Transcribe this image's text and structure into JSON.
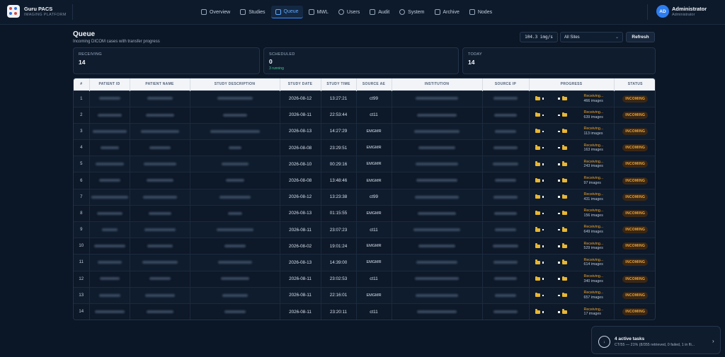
{
  "app": {
    "name": "Guru PACS",
    "subtitle": "IMAGING PLATFORM"
  },
  "nav": [
    {
      "label": "Overview",
      "icon": "grid-icon",
      "active": false
    },
    {
      "label": "Studies",
      "icon": "folder-icon",
      "active": false
    },
    {
      "label": "Queue",
      "icon": "queue-icon",
      "active": true
    },
    {
      "label": "MWL",
      "icon": "calendar-icon",
      "active": false
    },
    {
      "label": "Users",
      "icon": "users-icon",
      "active": false
    },
    {
      "label": "Audit",
      "icon": "document-icon",
      "active": false
    },
    {
      "label": "System",
      "icon": "gear-icon",
      "active": false
    },
    {
      "label": "Archive",
      "icon": "archive-icon",
      "active": false
    },
    {
      "label": "Nodes",
      "icon": "server-icon",
      "active": false
    }
  ],
  "user": {
    "initials": "AD",
    "name": "Administrator",
    "role": "Administrator"
  },
  "page": {
    "title": "Queue",
    "subtitle": "Incoming DICOM cases with transfer progress"
  },
  "toolbar": {
    "speed": "104.3 img/s",
    "site_select": "All Sites",
    "refresh_label": "Refresh"
  },
  "stats": {
    "receiving": {
      "label": "RECEIVING",
      "value": "14"
    },
    "scheduled": {
      "label": "SCHEDULED",
      "value": "0",
      "note": "3 running"
    },
    "today": {
      "label": "TODAY",
      "value": "14"
    }
  },
  "table": {
    "headers": [
      "#",
      "PATIENT ID",
      "PATIENT NAME",
      "STUDY DESCRIPTION",
      "STUDY DATE",
      "STUDY TIME",
      "SOURCE AE",
      "INSTITUTION",
      "SOURCE IP",
      "PROGRESS",
      "STATUS"
    ],
    "rows": [
      {
        "n": "1",
        "date": "2026-08-12",
        "time": "13:27:21",
        "ae": "ct99",
        "progress": "Receiving...",
        "images": "466 images",
        "status": "INCOMING"
      },
      {
        "n": "2",
        "date": "2026-08-11",
        "time": "22:53:44",
        "ae": "ct11",
        "progress": "Receiving...",
        "images": "639 images",
        "status": "INCOMING"
      },
      {
        "n": "3",
        "date": "2026-08-13",
        "time": "14:27:29",
        "ae": "EMGMR",
        "progress": "Receiving...",
        "images": "113 images",
        "status": "INCOMING"
      },
      {
        "n": "4",
        "date": "2026-08-08",
        "time": "23:29:51",
        "ae": "EMGMR",
        "progress": "Receiving...",
        "images": "163 images",
        "status": "INCOMING"
      },
      {
        "n": "5",
        "date": "2026-08-10",
        "time": "00:29:16",
        "ae": "EMGMR",
        "progress": "Receiving...",
        "images": "243 images",
        "status": "INCOMING"
      },
      {
        "n": "6",
        "date": "2026-08-08",
        "time": "13:48:46",
        "ae": "EMGMR",
        "progress": "Receiving...",
        "images": "97 images",
        "status": "INCOMING"
      },
      {
        "n": "7",
        "date": "2026-08-12",
        "time": "13:23:38",
        "ae": "ct99",
        "progress": "Receiving...",
        "images": "431 images",
        "status": "INCOMING"
      },
      {
        "n": "8",
        "date": "2026-08-13",
        "time": "01:15:55",
        "ae": "EMGMR",
        "progress": "Receiving...",
        "images": "156 images",
        "status": "INCOMING"
      },
      {
        "n": "9",
        "date": "2026-08-11",
        "time": "23:07:23",
        "ae": "ct11",
        "progress": "Receiving...",
        "images": "649 images",
        "status": "INCOMING"
      },
      {
        "n": "10",
        "date": "2026-08-02",
        "time": "19:01:24",
        "ae": "EMGMR",
        "progress": "Receiving...",
        "images": "529 images",
        "status": "INCOMING"
      },
      {
        "n": "11",
        "date": "2026-08-13",
        "time": "14:39:00",
        "ae": "EMGMR",
        "progress": "Receiving...",
        "images": "614 images",
        "status": "INCOMING"
      },
      {
        "n": "12",
        "date": "2026-08-11",
        "time": "23:02:53",
        "ae": "ct11",
        "progress": "Receiving...",
        "images": "340 images",
        "status": "INCOMING"
      },
      {
        "n": "13",
        "date": "2026-08-11",
        "time": "22:16:01",
        "ae": "EMGMR",
        "progress": "Receiving...",
        "images": "657 images",
        "status": "INCOMING"
      },
      {
        "n": "14",
        "date": "2026-08-11",
        "time": "23:20:11",
        "ae": "ct11",
        "progress": "Receiving...",
        "images": "17 images",
        "status": "INCOMING"
      }
    ]
  },
  "tasks": {
    "title": "4 active tasks",
    "detail": "CT/55 — 21% (8/355 retrieved, 0 failed, 1 in fli..."
  },
  "colors": {
    "accent": "#3d8bff",
    "warning": "#f0a42a",
    "success": "#3fcf8e",
    "background": "#0b1626"
  }
}
